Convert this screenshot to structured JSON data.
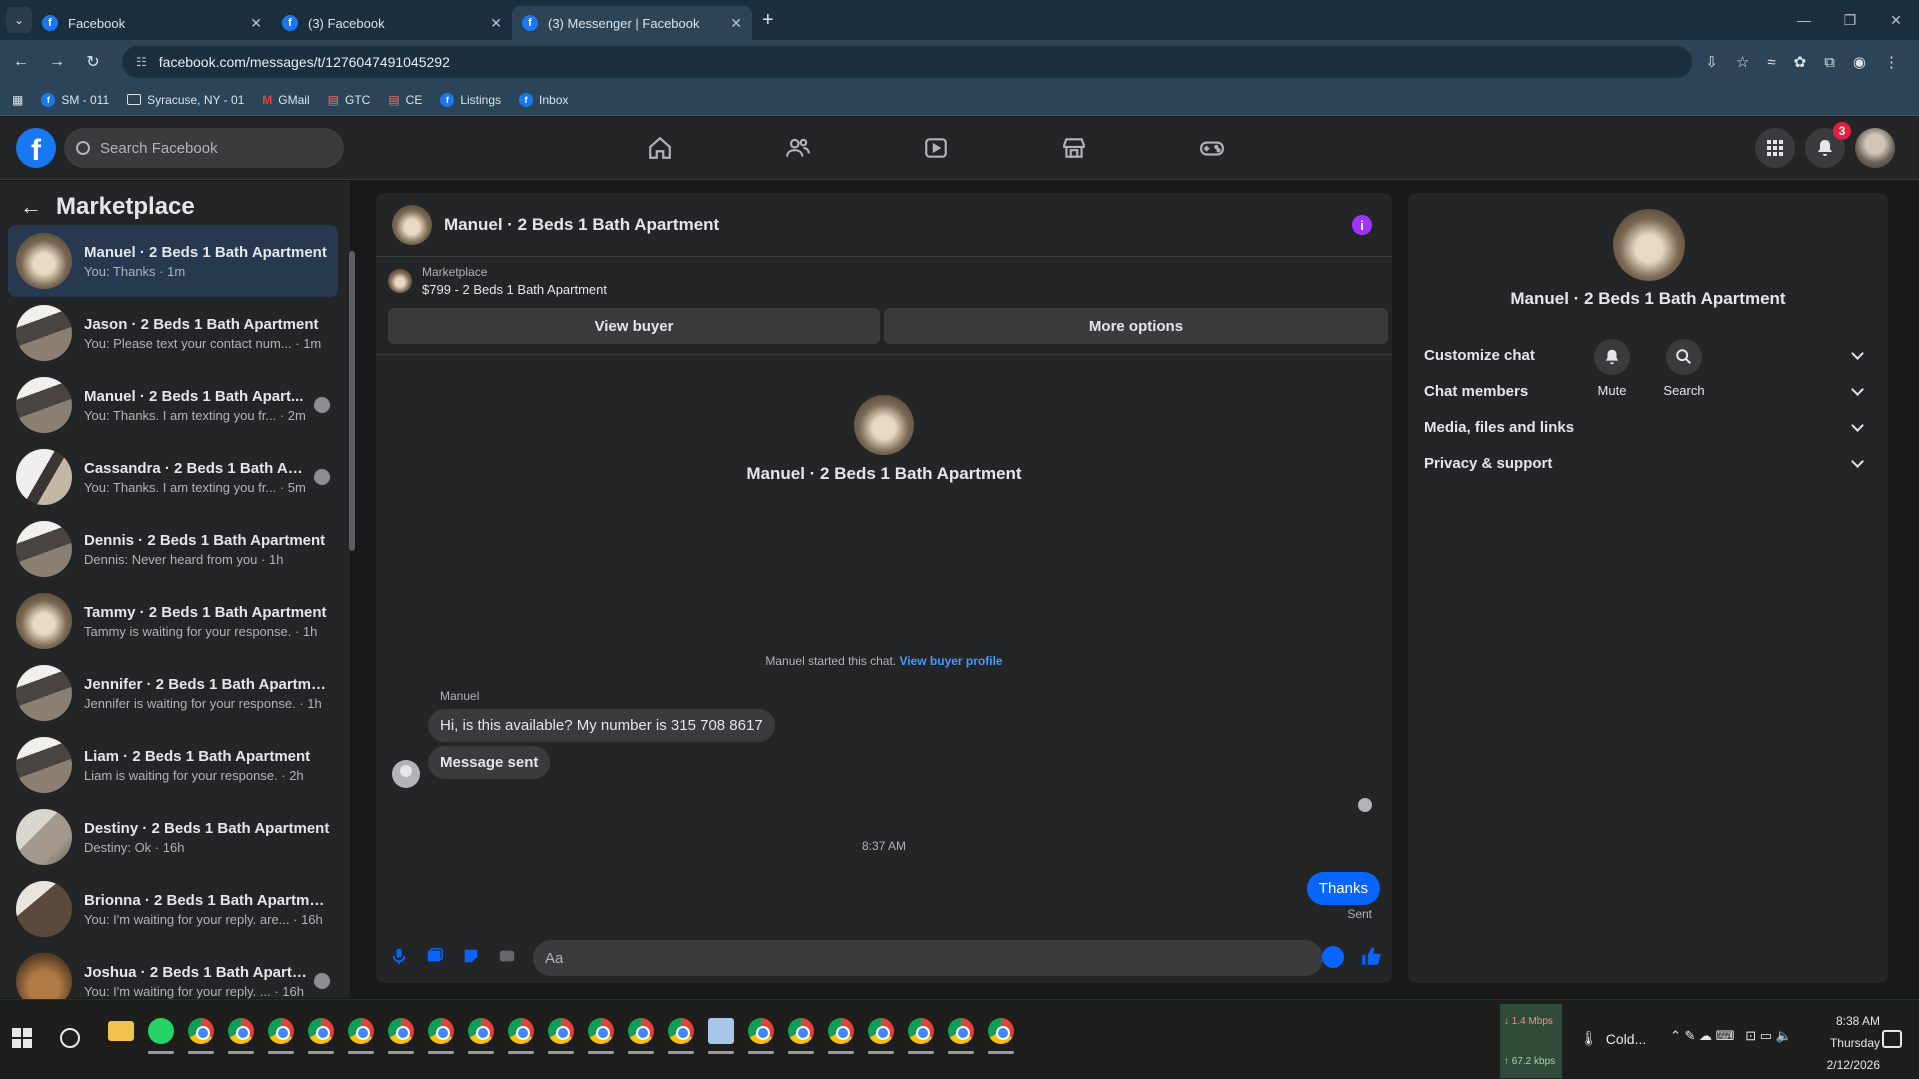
{
  "browser": {
    "tabs": [
      {
        "title": "Facebook",
        "active": false
      },
      {
        "title": "(3) Facebook",
        "active": false
      },
      {
        "title": "(3) Messenger | Facebook",
        "active": true
      }
    ],
    "url": "facebook.com/messages/t/1276047491045292",
    "bookmarks": [
      {
        "label": "SM - 011",
        "icon": "facebook-icon"
      },
      {
        "label": "Syracuse, NY - 01",
        "icon": "folder-icon"
      },
      {
        "label": "GMail",
        "icon": "gmail-icon"
      },
      {
        "label": "GTC",
        "icon": "bookmark-icon"
      },
      {
        "label": "CE",
        "icon": "bookmark-icon"
      },
      {
        "label": "Listings",
        "icon": "facebook-icon"
      },
      {
        "label": "Inbox",
        "icon": "facebook-icon"
      }
    ]
  },
  "fb": {
    "search_placeholder": "Search Facebook",
    "notifications_count": "3",
    "accent": "#1877f2"
  },
  "sidebar": {
    "title": "Marketplace",
    "conversations": [
      {
        "name": "Manuel · 2 Beds 1 Bath Apartment",
        "preview": "You: Thanks · 1m",
        "thumb": "t1",
        "active": true,
        "seen": false
      },
      {
        "name": "Jason · 2 Beds 1 Bath Apartment",
        "preview": "You: Please text your contact num... · 1m",
        "thumb": "t2",
        "active": false,
        "seen": false
      },
      {
        "name": "Manuel · 2 Beds 1 Bath Apart...",
        "preview": "You: Thanks. I am texting you fr... · 2m",
        "thumb": "t2",
        "active": false,
        "seen": true
      },
      {
        "name": "Cassandra · 2 Beds 1 Bath Apa...",
        "preview": "You: Thanks. I am texting you fr... · 5m",
        "thumb": "t4",
        "active": false,
        "seen": true
      },
      {
        "name": "Dennis · 2 Beds 1 Bath Apartment",
        "preview": "Dennis: Never heard from you · 1h",
        "thumb": "t2",
        "active": false,
        "seen": false
      },
      {
        "name": "Tammy · 2 Beds 1 Bath Apartment",
        "preview": "Tammy is waiting for your response. · 1h",
        "thumb": "t1",
        "active": false,
        "seen": false
      },
      {
        "name": "Jennifer · 2 Beds 1 Bath Apartme...",
        "preview": "Jennifer is waiting for your response. · 1h",
        "thumb": "t2",
        "active": false,
        "seen": false
      },
      {
        "name": "Liam · 2 Beds 1 Bath Apartment",
        "preview": "Liam is waiting for your response. · 2h",
        "thumb": "t2",
        "active": false,
        "seen": false
      },
      {
        "name": "Destiny · 2 Beds 1 Bath Apartment",
        "preview": "Destiny: Ok · 16h",
        "thumb": "t3",
        "active": false,
        "seen": false
      },
      {
        "name": "Brionna · 2 Beds 1 Bath Apartme...",
        "preview": "You: I'm waiting for your reply. are... · 16h",
        "thumb": "t5",
        "active": false,
        "seen": false
      },
      {
        "name": "Joshua · 2 Beds 1 Bath Apartm...",
        "preview": "You: I'm waiting for your reply. ... · 16h",
        "thumb": "t6",
        "active": false,
        "seen": true
      }
    ]
  },
  "chat": {
    "title": "Manuel · 2 Beds 1 Bath Apartment",
    "marketplace_label": "Marketplace",
    "listing": "$799 - 2 Beds 1 Bath Apartment",
    "view_buyer": "View buyer",
    "more_options": "More options",
    "center_name": "Manuel · 2 Beds 1 Bath Apartment",
    "started_text": "Manuel started this chat.",
    "view_buyer_profile": "View buyer profile",
    "sender": "Manuel",
    "msg1": "Hi, is this available? My number is 315 708 8617",
    "msg2": "Message sent",
    "time": "8:37 AM",
    "out_msg": "Thanks",
    "sent_label": "Sent",
    "composer_placeholder": "Aa"
  },
  "details": {
    "name": "Manuel · 2 Beds 1 Bath Apartment",
    "mute": "Mute",
    "search": "Search",
    "sections": [
      "Customize chat",
      "Chat members",
      "Media, files and links",
      "Privacy & support"
    ]
  },
  "taskbar": {
    "download": "1.4 Mbps",
    "upload": "67.2 kbps",
    "weather": "Cold...",
    "time": "8:38 AM",
    "day": "Thursday",
    "date": "2/12/2026"
  }
}
